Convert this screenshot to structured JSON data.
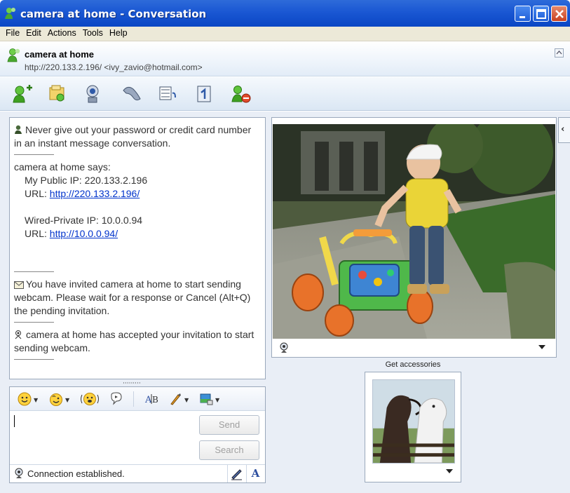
{
  "window": {
    "title": "camera at home - Conversation"
  },
  "menu": [
    "File",
    "Edit",
    "Actions",
    "Tools",
    "Help"
  ],
  "contact": {
    "name": "camera at home",
    "address": "http://220.133.2.196/ <ivy_zavio@hotmail.com>"
  },
  "toolbar": {
    "icons": [
      "invite-contact-icon",
      "send-files-icon",
      "webcam-icon",
      "call-icon",
      "video-call-icon",
      "activities-icon",
      "block-contact-icon"
    ]
  },
  "chat": {
    "warning": "Never give out your password or credit card number in an instant message conversation.",
    "says": "camera at home says:",
    "public_ip": "My Public IP: 220.133.2.196",
    "url_label": "URL: ",
    "public_url": "http://220.133.2.196/",
    "private_ip": "Wired-Private IP: 10.0.0.94",
    "private_url": "http://10.0.0.94/",
    "invite_msg": "You have invited camera at home to start sending webcam. Please wait for a response or Cancel (Alt+Q) the pending invitation.",
    "accepted_msg": "camera at home has accepted your invitation to start sending webcam."
  },
  "compose": {
    "send_label": "Send",
    "search_label": "Search",
    "status": "Connection established.",
    "font_glyph": "A"
  },
  "accessories": {
    "label": "Get accessories"
  },
  "colors": {
    "titlebar": "#1a57d3",
    "link": "#0033cc",
    "panel_bg": "#e9eef6"
  }
}
